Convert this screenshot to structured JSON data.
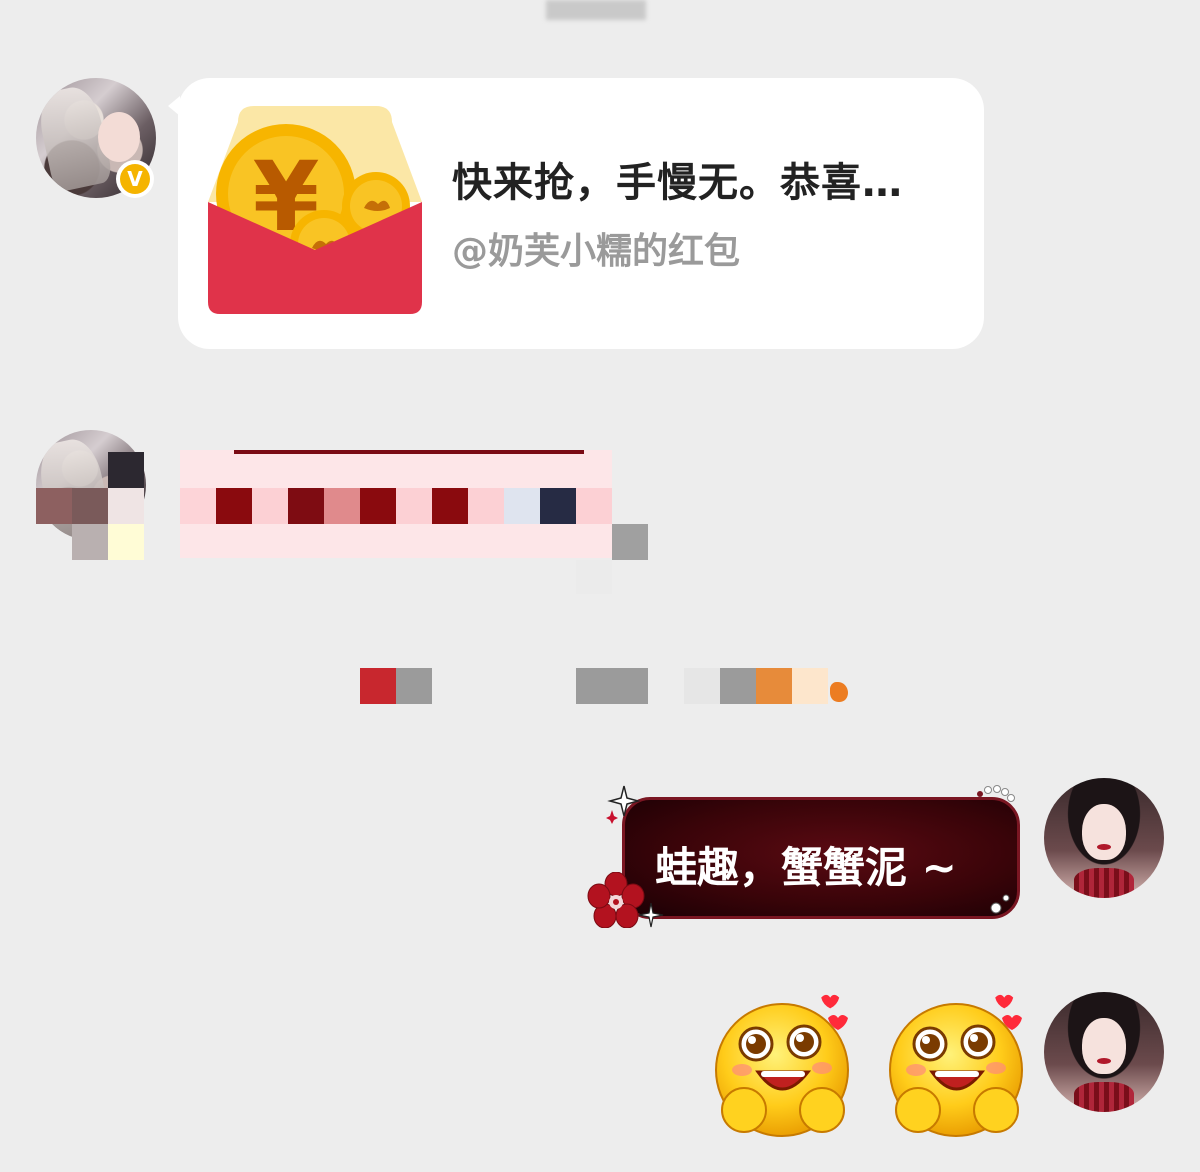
{
  "chat": {
    "messages": [
      {
        "sender": "other",
        "verified_badge": "V",
        "type": "red_packet",
        "title": "快来抢，手慢无。恭喜…",
        "subtitle": "@奶芙小糯的红包",
        "icon": "red-envelope-icon"
      },
      {
        "sender": "other",
        "type": "text",
        "redacted": true
      },
      {
        "type": "system_notice",
        "redacted": true
      },
      {
        "sender": "self",
        "type": "text",
        "text": "蛙趣，蟹蟹泥 ~"
      },
      {
        "sender": "self",
        "type": "stickers",
        "icons": [
          "happy-face-hearts-icon",
          "happy-face-hearts-icon"
        ]
      }
    ]
  },
  "colors": {
    "background": "#ededed",
    "card": "#ffffff",
    "packet_red": "#e0334a",
    "coin_gold": "#f7b500",
    "bubble_dark_red": "#3a0409",
    "badge_gold": "#f5b400"
  }
}
